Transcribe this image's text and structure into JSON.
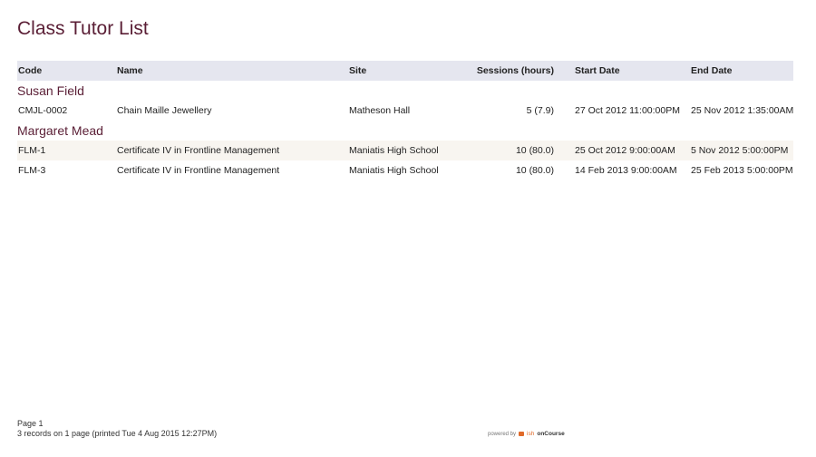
{
  "report": {
    "title": "Class Tutor List",
    "columns": {
      "code": "Code",
      "name": "Name",
      "site": "Site",
      "sessions": "Sessions (hours)",
      "start": "Start Date",
      "end": "End Date"
    },
    "groups": [
      {
        "tutor": "Susan Field",
        "rows": [
          {
            "code": "CMJL-0002",
            "name": "Chain Maille Jewellery",
            "site": "Matheson Hall",
            "sessions": "5 (7.9)",
            "start": "27 Oct 2012 11:00:00PM",
            "end": "25 Nov 2012 1:35:00AM"
          }
        ]
      },
      {
        "tutor": "Margaret Mead",
        "rows": [
          {
            "code": "FLM-1",
            "name": "Certificate IV in Frontline Management",
            "site": "Maniatis High School",
            "sessions": "10 (80.0)",
            "start": "25 Oct 2012 9:00:00AM",
            "end": "5 Nov 2012 5:00:00PM"
          },
          {
            "code": "FLM-3",
            "name": "Certificate IV in Frontline Management",
            "site": "Maniatis High School",
            "sessions": "10 (80.0)",
            "start": "14 Feb 2013 9:00:00AM",
            "end": "25 Feb 2013 5:00:00PM"
          }
        ]
      }
    ]
  },
  "footer": {
    "page": "Page 1",
    "summary": "3 records on 1 page (printed Tue 4 Aug 2015 12:27PM)",
    "powered_by": "powered by",
    "brand_prefix": "ish",
    "brand_name": "onCourse",
    "brand_color": "#e06a2a"
  },
  "colors": {
    "title": "#5a1e35",
    "header_bg": "#e5e6ef",
    "alt_row_bg": "#f8f5f0"
  }
}
